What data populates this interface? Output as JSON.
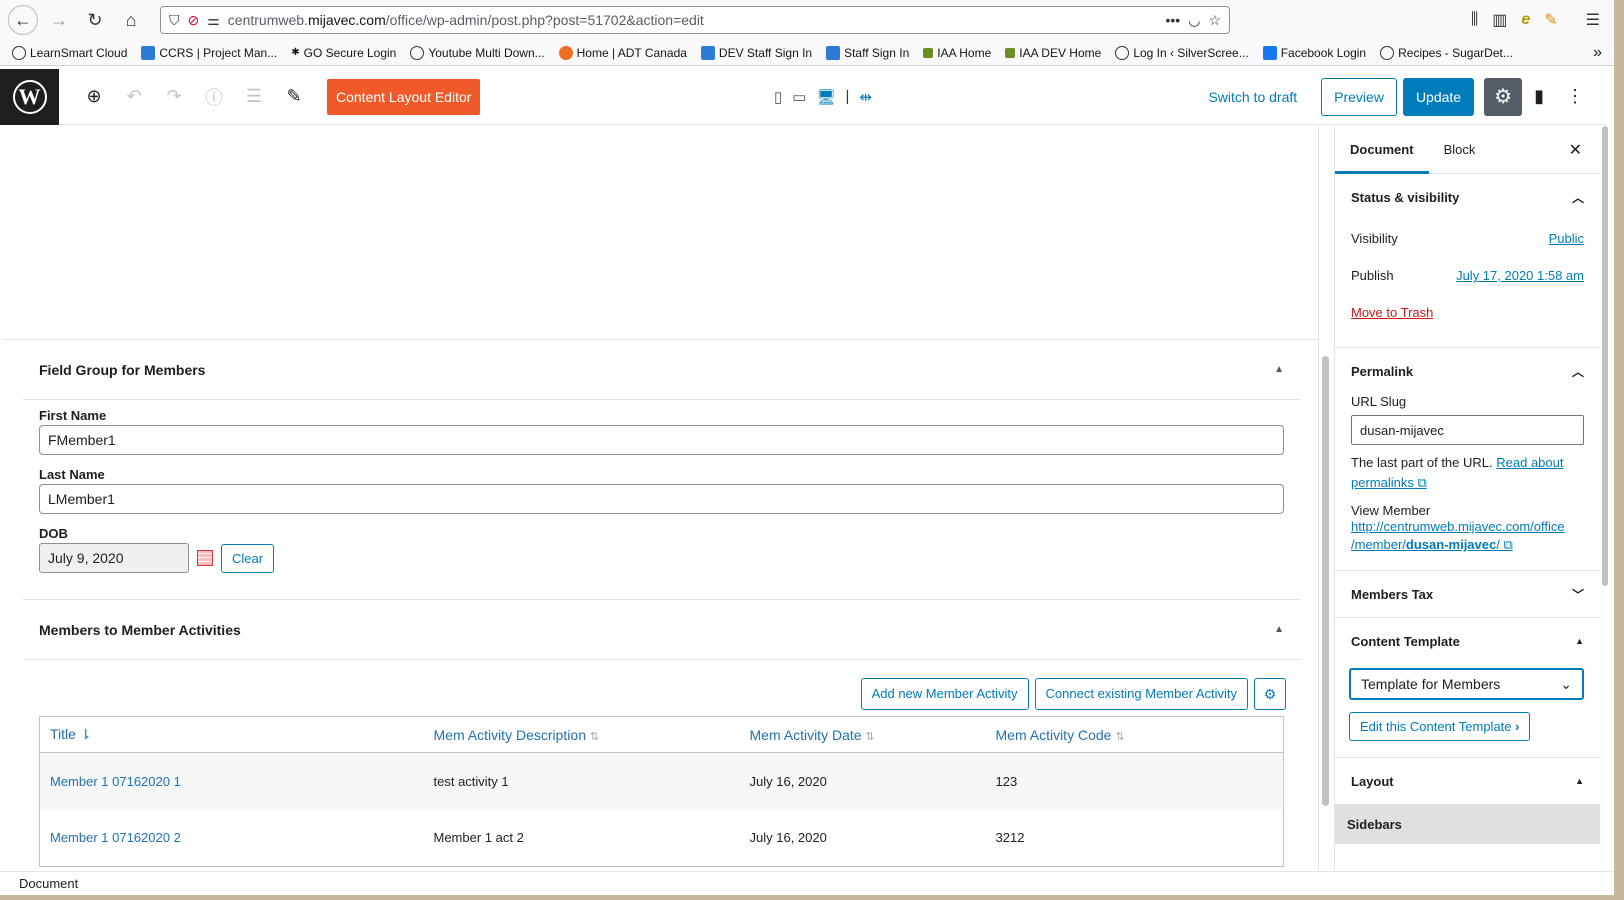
{
  "browser": {
    "url_prefix": "centrumweb.",
    "url_domain": "mijavec.com",
    "url_path": "/office/wp-admin/post.php?post=51702&action=edit",
    "bookmarks": [
      {
        "label": "LearnSmart Cloud",
        "icon": "globe-icon"
      },
      {
        "label": "CCRS | Project Man...",
        "icon": "project-icon"
      },
      {
        "label": "GO Secure Login",
        "icon": "gear-icon"
      },
      {
        "label": "Youtube Multi Down...",
        "icon": "globe-icon"
      },
      {
        "label": "Home | ADT Canada",
        "icon": "adt-icon"
      },
      {
        "label": "DEV Staff Sign In",
        "icon": "staff-icon"
      },
      {
        "label": "Staff Sign In",
        "icon": "staff-icon"
      },
      {
        "label": "IAA Home",
        "icon": "iaa-icon"
      },
      {
        "label": "IAA DEV Home",
        "icon": "iaa-icon"
      },
      {
        "label": "Log In ‹ SilverScree...",
        "icon": "globe-icon"
      },
      {
        "label": "Facebook Login",
        "icon": "facebook-icon"
      },
      {
        "label": "Recipes - SugarDet...",
        "icon": "globe-icon"
      }
    ]
  },
  "toolbar": {
    "content_layout_editor": "Content Layout Editor",
    "switch_to_draft": "Switch to draft",
    "preview": "Preview",
    "update": "Update"
  },
  "field_group": {
    "title": "Field Group for Members",
    "first_name_label": "First Name",
    "first_name_value": "FMember1",
    "last_name_label": "Last Name",
    "last_name_value": "LMember1",
    "dob_label": "DOB",
    "dob_value": "July 9, 2020",
    "clear_label": "Clear"
  },
  "relationship": {
    "title": "Members to Member Activities",
    "add_new": "Add new Member Activity",
    "connect_existing": "Connect existing Member Activity",
    "columns": [
      "Title",
      "Mem Activity Description",
      "Mem Activity Date",
      "Mem Activity Code"
    ],
    "rows": [
      {
        "title": "Member 1 07162020 1",
        "description": "test activity 1",
        "date": "July 16, 2020",
        "code": "123"
      },
      {
        "title": "Member 1 07162020 2",
        "description": "Member 1 act 2",
        "date": "July 16, 2020",
        "code": "3212"
      }
    ]
  },
  "sidebar": {
    "tab_document": "Document",
    "tab_block": "Block",
    "status_title": "Status & visibility",
    "visibility_label": "Visibility",
    "visibility_value": "Public",
    "publish_label": "Publish",
    "publish_value": "July 17, 2020 1:58 am",
    "move_to_trash": "Move to Trash",
    "permalink_title": "Permalink",
    "url_slug_label": "URL Slug",
    "url_slug_value": "dusan-mijavec",
    "help_text": "The last part of the URL.",
    "read_about": "Read about",
    "permalinks": "permalinks",
    "view_member_label": "View Member",
    "view_member_url_1": "http://centrumweb.mijavec.com/office",
    "view_member_url_2": "/member/",
    "view_member_url_3": "dusan-mijavec",
    "view_member_url_4": "/",
    "members_tax_title": "Members Tax",
    "content_template_title": "Content Template",
    "template_selected": "Template for Members",
    "edit_template": "Edit this Content Template",
    "layout_title": "Layout",
    "sidebars_label": "Sidebars"
  },
  "status_bar": {
    "text": "Document"
  }
}
